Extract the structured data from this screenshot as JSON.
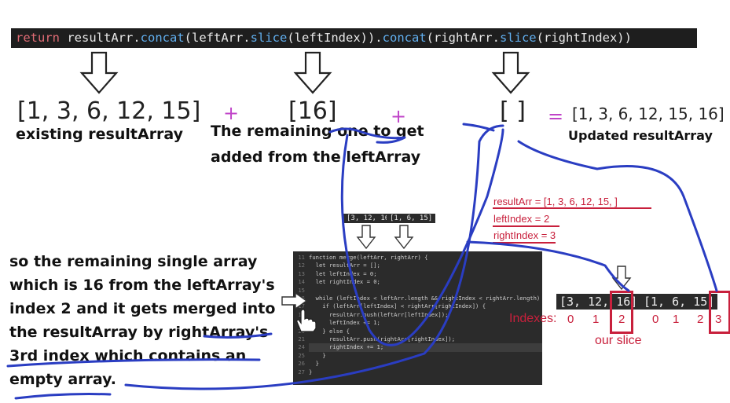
{
  "code_line": {
    "return_kw": "return",
    "t1": " resultArr.",
    "concat1": "concat",
    "t2": "(leftArr.",
    "slice1": "slice",
    "t3": "(leftIndex)).",
    "concat2": "concat",
    "t4": "(rightArr.",
    "slice2": "slice",
    "t5": "(rightIndex))"
  },
  "equation": {
    "existing_array": "[1, 3, 6, 12, 15]",
    "existing_label": "existing resultArray",
    "plus1": "+",
    "left_slice": "[16]",
    "left_slice_note_line1": "The remaining one to get",
    "left_slice_note_line2": "added from the leftArray",
    "plus2": "+",
    "right_slice": "[ ]",
    "equals": "=",
    "result": "[1, 3, 6, 12, 15, 16]",
    "result_label": "Updated resultArray"
  },
  "explanation": {
    "line1": "so the remaining single array",
    "line2": "which is 16 from the leftArray's",
    "line3": "index 2 and it gets merged into",
    "line4": "the resultArray by rightArray's",
    "line5": "3rd index which contains an",
    "line6": "empty array."
  },
  "state": {
    "result_arr": "resultArr = [1, 3, 6, 12, 15,      ]",
    "left_index": "leftIndex = 2",
    "right_index": "rightIndex = 3"
  },
  "arrays": {
    "left_tag": "[3, 12, 16]",
    "right_tag": "[1, 6, 15]",
    "left_array": "[3, 12, 16]",
    "right_array": "[1, 6, 15]",
    "indexes_label": "Indexes:",
    "left_indexes": [
      "0",
      "1",
      "2"
    ],
    "right_indexes": [
      "0",
      "1",
      "2",
      "3"
    ],
    "slice_label": "our slice"
  },
  "editor": {
    "lines": [
      {
        "n": "11",
        "t": "function merge(leftArr, rightArr) {"
      },
      {
        "n": "12",
        "t": "  let resultArr = [];"
      },
      {
        "n": "13",
        "t": "  let leftIndex = 0;"
      },
      {
        "n": "14",
        "t": "  let rightIndex = 0;"
      },
      {
        "n": "15",
        "t": ""
      },
      {
        "n": "16",
        "t": "  while (leftIndex < leftArr.length && rightIndex < rightArr.length) {"
      },
      {
        "n": "17",
        "t": "    if (leftArr[leftIndex] < rightArr[rightIndex]) {"
      },
      {
        "n": "18",
        "t": "      resultArr.push(leftArr[leftIndex]);"
      },
      {
        "n": "19",
        "t": "      leftIndex += 1;"
      },
      {
        "n": "20",
        "t": "    } else {"
      },
      {
        "n": "21",
        "t": "      resultArr.push(rightArr[rightIndex]);"
      },
      {
        "n": "24",
        "t": "      rightIndex += 1;"
      },
      {
        "n": "25",
        "t": "    }"
      },
      {
        "n": "26",
        "t": "  }"
      },
      {
        "n": "27",
        "t": "}"
      }
    ]
  },
  "colors": {
    "ink_blue": "#2a3dc2",
    "red": "#c8203c",
    "purple": "#c044c8"
  }
}
